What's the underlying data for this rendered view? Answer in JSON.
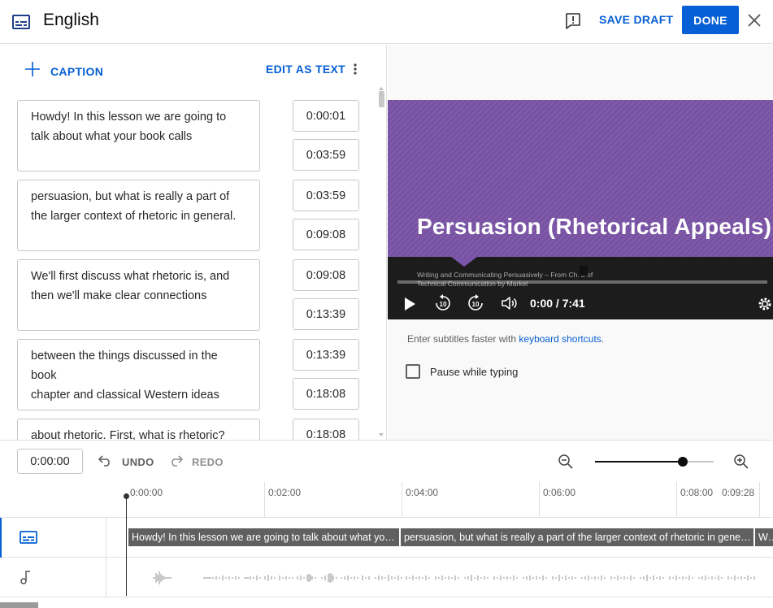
{
  "header": {
    "title": "English",
    "save_draft": "SAVE DRAFT",
    "done": "DONE"
  },
  "toolbar": {
    "add_caption": "CAPTION",
    "edit_as_text": "EDIT AS TEXT"
  },
  "captions": [
    {
      "text": "Howdy! In this lesson we are going to\ntalk about what your book calls",
      "start": "0:00:01",
      "end": "0:03:59"
    },
    {
      "text": "persuasion, but what is really a part of\nthe larger context of rhetoric in general.",
      "start": "0:03:59",
      "end": "0:09:08"
    },
    {
      "text": "We'll first discuss what rhetoric is, and\nthen we'll make clear connections",
      "start": "0:09:08",
      "end": "0:13:39"
    },
    {
      "text": "between the things discussed in the\nbook\nchapter and classical Western ideas",
      "start": "0:13:39",
      "end": "0:18:08"
    },
    {
      "text": "about rhetoric. First, what is rhetoric?",
      "start": "0:18:08",
      "end": ""
    }
  ],
  "video": {
    "slide_title": "Persuasion (Rhetorical Appeals)",
    "slide_sub1": "Writing and Communicating Persuasively – From Ch. 8 of",
    "slide_sub2": "Technical Communication by Markel",
    "timecode": "0:00 / 7:41",
    "progress": 0
  },
  "hint": {
    "prefix": "Enter subtitles faster with ",
    "link": "keyboard shortcuts",
    "suffix": "."
  },
  "pause_while_typing": {
    "label": "Pause while typing",
    "checked": false
  },
  "timeline": {
    "current_time": "0:00:00",
    "undo": "UNDO",
    "redo": "REDO",
    "zoom_level": 0.74,
    "ticks": [
      "0:00:00",
      "0:02:00",
      "0:04:00",
      "0:06:00",
      "0:08:00",
      "0:09:28"
    ],
    "subtitle_blocks": [
      "Howdy! In this lesson we are going to talk about what your book calls",
      "persuasion, but what is really a part of the larger context of rhetoric in general.",
      "We'll first discuss what rhetoric is, and then we'll make clear connections"
    ]
  },
  "icons": {
    "language": "subtitles-icon",
    "feedback": "feedback-icon",
    "close": "close-icon",
    "add": "plus-icon",
    "more": "more-vert-icon",
    "play": "play-icon",
    "rewind": "replay-10-icon",
    "forward": "forward-10-icon",
    "volume": "volume-icon",
    "settings": "gear-icon",
    "undo": "undo-icon",
    "redo": "redo-icon",
    "zoom_out": "zoom-out-icon",
    "zoom_in": "zoom-in-icon",
    "audio": "music-note-icon"
  },
  "colors": {
    "accent": "#065fd4",
    "slide_background": "#7b55a7",
    "subtitle_block": "#606060"
  }
}
